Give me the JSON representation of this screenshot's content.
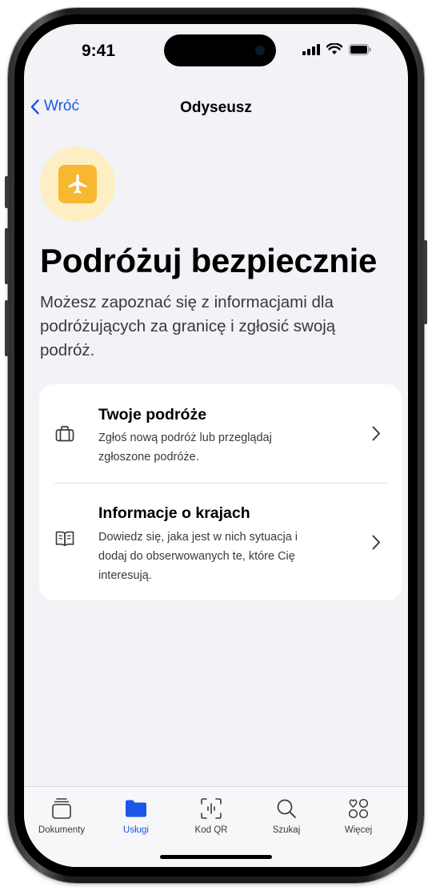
{
  "status": {
    "time": "9:41"
  },
  "nav": {
    "back_label": "Wróć",
    "title": "Odyseusz"
  },
  "hero": {
    "icon": "airplane-icon",
    "accent": "#f7b731",
    "circle_color": "#fdeec4"
  },
  "headline": "Podróżuj bezpiecznie",
  "lead": "Możesz zapoznać się z informacjami dla podróżujących za granicę i zgłosić swoją podróż.",
  "card": {
    "items": [
      {
        "icon": "suitcase-icon",
        "title": "Twoje podróże",
        "description": "Zgłoś nową podróż lub przeglądaj zgłoszone podróże."
      },
      {
        "icon": "book-icon",
        "title": "Informacje o krajach",
        "description": "Dowiedz się, jaka jest w nich sytuacja i dodaj do obserwowanych te, które Cię interesują."
      }
    ]
  },
  "tabbar": {
    "items": [
      {
        "label": "Dokumenty",
        "icon": "documents-icon",
        "active": false
      },
      {
        "label": "Usługi",
        "icon": "folder-icon",
        "active": true
      },
      {
        "label": "Kod QR",
        "icon": "qr-scan-icon",
        "active": false
      },
      {
        "label": "Szukaj",
        "icon": "search-icon",
        "active": false
      },
      {
        "label": "Więcej",
        "icon": "more-icon",
        "active": false
      }
    ]
  },
  "colors": {
    "accent_blue": "#1a56e8",
    "background": "#f2f2f7"
  }
}
